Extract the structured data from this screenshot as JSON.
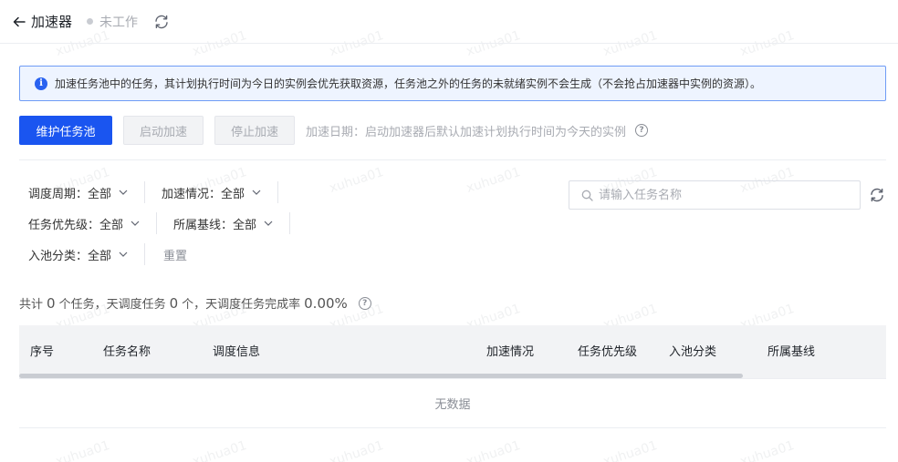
{
  "header": {
    "title": "加速器",
    "status": "未工作"
  },
  "alert": {
    "text": "加速任务池中的任务，其计划执行时间为今日的实例会优先获取资源，任务池之外的任务的未就绪实例不会生成（不会抢占加速器中实例的资源）。"
  },
  "toolbar": {
    "maintain_label": "维护任务池",
    "start_label": "启动加速",
    "stop_label": "停止加速",
    "tip": "加速日期：启动加速器后默认加速计划执行时间为今天的实例"
  },
  "filters": {
    "schedule_cycle": "调度周期：全部",
    "accel_status": "加速情况：全部",
    "priority": "任务优先级：全部",
    "baseline": "所属基线：全部",
    "pool_category": "入池分类：全部",
    "reset_label": "重置"
  },
  "search": {
    "placeholder": "请输入任务名称"
  },
  "summary": {
    "prefix": "共计",
    "total": "0",
    "part1": "个任务，天调度任务",
    "daily": "0",
    "part2": "个，天调度任务完成率",
    "rate": "0.00%"
  },
  "table": {
    "columns": [
      "序号",
      "任务名称",
      "调度信息",
      "加速情况",
      "任务优先级",
      "入池分类",
      "所属基线"
    ],
    "empty_text": "无数据"
  },
  "watermark": "xuhua01",
  "colors": {
    "primary": "#1a55f0",
    "alert_bg": "#eef4ff",
    "alert_border": "#6f9cf5"
  }
}
